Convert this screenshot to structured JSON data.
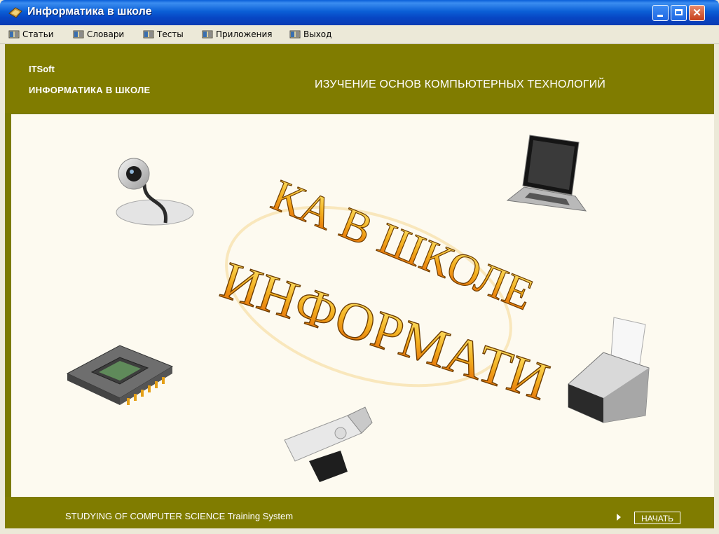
{
  "window": {
    "title": "Информатика в школе",
    "min_label": "",
    "max_label": "",
    "close_label": "✕"
  },
  "menu": {
    "items": [
      {
        "label": "Статьи",
        "icon": "menu-book-icon"
      },
      {
        "label": "Словари",
        "icon": "menu-book-icon"
      },
      {
        "label": "Тесты",
        "icon": "menu-book-icon"
      },
      {
        "label": "Приложения",
        "icon": "menu-book-icon"
      },
      {
        "label": "Выход",
        "icon": "menu-book-icon"
      }
    ]
  },
  "header": {
    "brand": "ITSoft",
    "subtitle": "ИНФОРМАТИКА В ШКОЛЕ",
    "headline": "ИЗУЧЕНИЕ ОСНОВ КОМПЬЮТЕРНЫХ ТЕХНОЛОГИЙ"
  },
  "stage": {
    "logo_front": "ИНФОРМАТИ",
    "logo_back": "КА В ШКОЛЕ",
    "devices": [
      "webcam-icon",
      "laptop-icon",
      "processor-chip-icon",
      "printer-icon",
      "usb-flash-drive-icon"
    ]
  },
  "footer": {
    "text": "STUDYING OF COMPUTER SCIENCE Training System",
    "start_label": "НАЧАТЬ"
  },
  "colors": {
    "olive": "#807c00",
    "stage_bg": "#fdfaf0",
    "titlebar": "#0b5fd6"
  }
}
